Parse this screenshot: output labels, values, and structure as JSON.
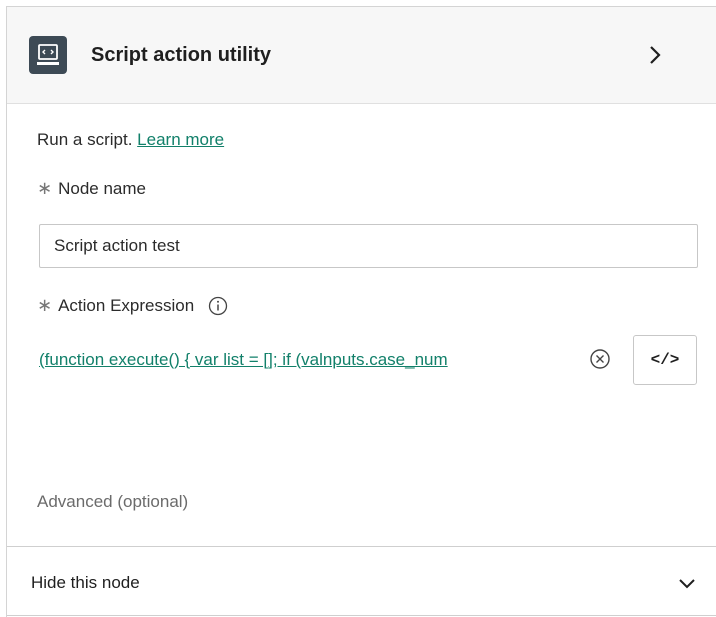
{
  "header": {
    "title": "Script action utility",
    "icon": "script-code-icon",
    "expand_icon": "chevron-right-icon"
  },
  "description": {
    "text": "Run a script.",
    "link_label": "Learn more"
  },
  "node_name": {
    "required_marker": "∗",
    "label": "Node name",
    "value": "Script action test"
  },
  "action_expression": {
    "required_marker": "∗",
    "label": "Action Expression",
    "info_icon": "info-icon",
    "value": "(function execute() { var list = []; if (valnputs.case_num",
    "clear_icon": "clear-circle-icon",
    "editor_button_label": "</>"
  },
  "advanced": {
    "label": "Advanced (optional)"
  },
  "hide_node": {
    "label": "Hide this node",
    "toggle_icon": "chevron-down-icon"
  },
  "colors": {
    "link": "#12806a",
    "header_bg": "#f7f7f7",
    "icon_bg": "#3d4a55"
  }
}
